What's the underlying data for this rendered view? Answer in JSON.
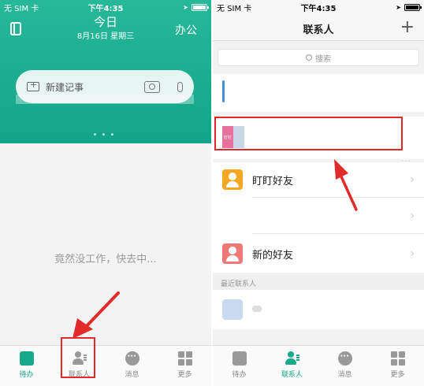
{
  "left": {
    "status": {
      "carrier": "无 SIM 卡",
      "time": "下午4:35"
    },
    "header": {
      "title": "今日",
      "date": "8月16日  星期三",
      "office": "办公"
    },
    "new_note": {
      "label": "新建记事"
    },
    "empty_text": "竟然没工作，快去中...",
    "tabs": [
      "待办",
      "联系人",
      "消息",
      "更多"
    ],
    "active_tab": "待办"
  },
  "right": {
    "status": {
      "carrier": "无 SIM 卡",
      "time": "下午4:35"
    },
    "header": {
      "title": "联系人",
      "add": "+"
    },
    "search": {
      "placeholder": "搜索"
    },
    "rows": [
      {
        "label": "盯盯好友",
        "icon": "friends-icon",
        "color": "#f5a623"
      },
      {
        "label": "",
        "icon": "",
        "color": ""
      },
      {
        "label": "新的好友",
        "icon": "new-friend-icon",
        "color": "#f07878"
      }
    ],
    "section_recent": "最近联系人",
    "team_thumb_text": "钉钉",
    "tabs": [
      "待办",
      "联系人",
      "消息",
      "更多"
    ],
    "active_tab": "联系人"
  },
  "colors": {
    "accent": "#18a88c",
    "annotation": "#e12b2b"
  }
}
